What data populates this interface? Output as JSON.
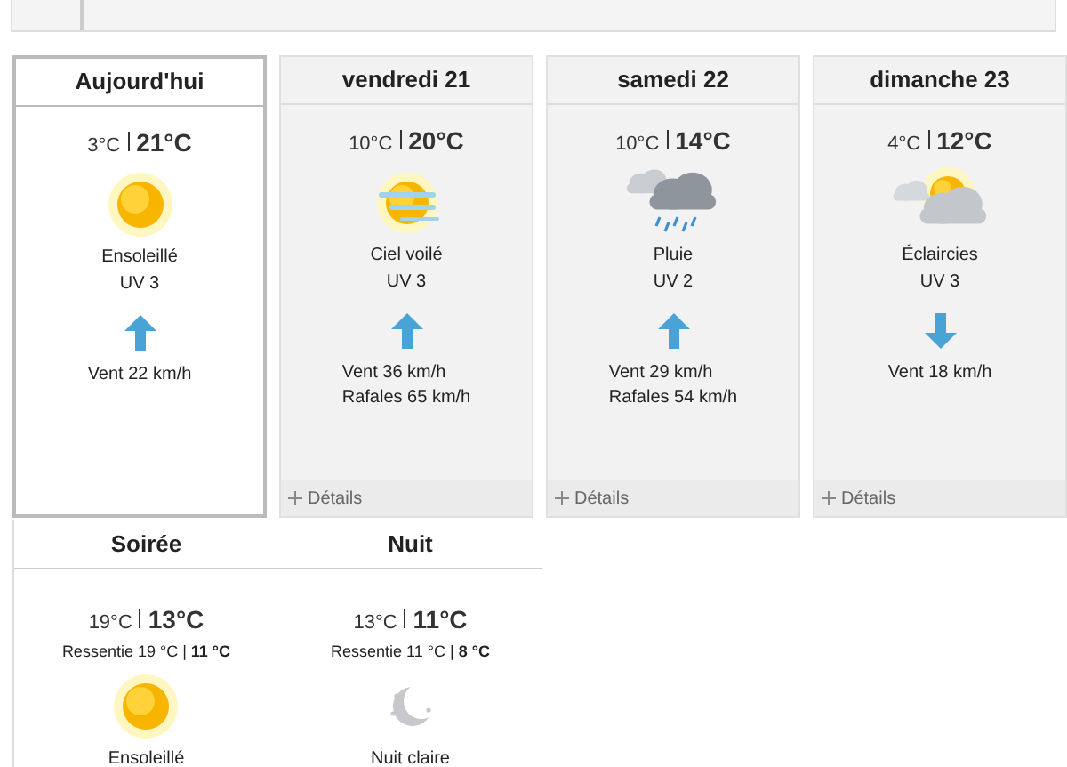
{
  "days": [
    {
      "label": "Aujourd'hui",
      "selected": true,
      "low": "3°C",
      "high": "21°C",
      "symbol": {
        "kind": "sun"
      },
      "condition": "Ensoleillé",
      "uv": "UV 3",
      "arrow": {
        "kind": "up"
      },
      "wind": "Vent 22 km/h"
    },
    {
      "label": "vendredi 21",
      "selected": false,
      "low": "10°C",
      "high": "20°C",
      "symbol": {
        "kind": "haze"
      },
      "condition": "Ciel voilé",
      "uv": "UV 3",
      "arrow": {
        "kind": "up"
      },
      "wind": "Vent 36 km/h",
      "gusts": "Rafales 65 km/h",
      "details": "Détails"
    },
    {
      "label": "samedi 22",
      "selected": false,
      "low": "10°C",
      "high": "14°C",
      "symbol": {
        "kind": "rain"
      },
      "condition": "Pluie",
      "uv": "UV 2",
      "arrow": {
        "kind": "up"
      },
      "wind": "Vent 29 km/h",
      "gusts": "Rafales 54 km/h",
      "details": "Détails"
    },
    {
      "label": "dimanche 23",
      "selected": false,
      "low": "4°C",
      "high": "12°C",
      "symbol": {
        "kind": "partly"
      },
      "condition": "Éclaircies",
      "uv": "UV 3",
      "arrow": {
        "kind": "down"
      },
      "wind": "Vent 18 km/h",
      "details": "Détails"
    }
  ],
  "periods": [
    {
      "label": "Soirée",
      "low": "19°C",
      "high": "13°C",
      "feels_like": "Ressentie 19 °C | **11 °C**",
      "symbol": {
        "kind": "sun"
      },
      "condition": "Ensoleillé"
    },
    {
      "label": "Nuit",
      "low": "13°C",
      "high": "11°C",
      "feels_like": "Ressentie 11 °C | **8 °C**",
      "symbol": {
        "kind": "night"
      },
      "condition": "Nuit claire"
    }
  ]
}
